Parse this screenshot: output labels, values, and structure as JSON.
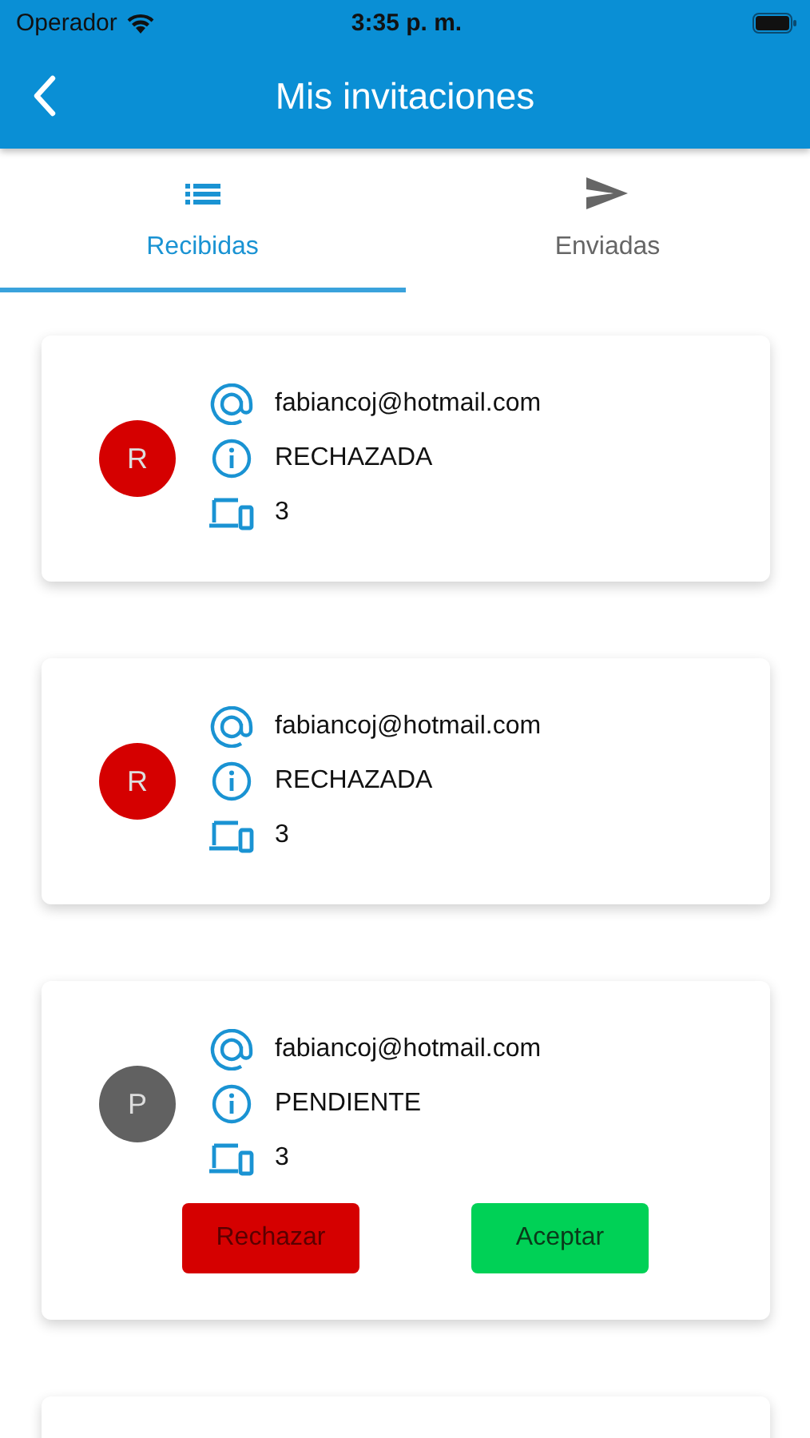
{
  "status_bar": {
    "carrier": "Operador",
    "time": "3:35 p. m."
  },
  "header": {
    "title": "Mis invitaciones"
  },
  "tabs": [
    {
      "label": "Recibidas",
      "kind": "list",
      "selected": true
    },
    {
      "label": "Enviadas",
      "kind": "send",
      "selected": false
    }
  ],
  "invitations": [
    {
      "avatar": "R",
      "color": "#d50000",
      "email": "fabiancoj@hotmail.com",
      "status": "RECHAZADA",
      "devices": "3"
    },
    {
      "avatar": "R",
      "color": "#d50000",
      "email": "fabiancoj@hotmail.com",
      "status": "RECHAZADA",
      "devices": "3"
    },
    {
      "avatar": "P",
      "color": "#616161",
      "email": "fabiancoj@hotmail.com",
      "status": "PENDIENTE",
      "devices": "3",
      "actions": [
        {
          "label": "Rechazar",
          "kind": "reject"
        },
        {
          "label": "Aceptar",
          "kind": "accept"
        }
      ]
    }
  ]
}
